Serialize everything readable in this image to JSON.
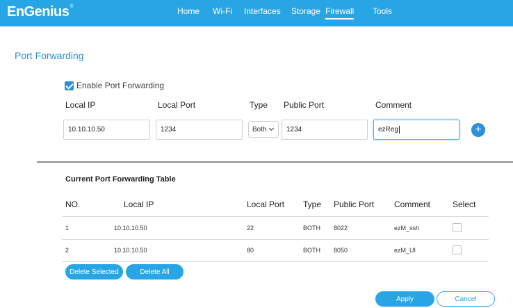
{
  "brand": {
    "name": "EnGenius",
    "mark": "®"
  },
  "nav": {
    "items": [
      {
        "label": "Home"
      },
      {
        "label": "Wi-Fi"
      },
      {
        "label": "Interfaces"
      },
      {
        "label": "Storage"
      },
      {
        "label": "Firewall",
        "active": true
      },
      {
        "label": "Tools"
      }
    ]
  },
  "page": {
    "title": "Port Forwarding"
  },
  "form": {
    "enable_label": "Enable Port Forwarding",
    "enabled": true,
    "labels": {
      "local_ip": "Local IP",
      "local_port": "Local Port",
      "type": "Type",
      "public_port": "Public Port",
      "comment": "Comment"
    },
    "values": {
      "local_ip": "10.10.10.50",
      "local_port": "1234",
      "type": "Both",
      "public_port": "1234",
      "comment": "ezReg"
    },
    "add_icon": "plus-icon",
    "add_symbol": "+"
  },
  "table": {
    "title": "Current Port Forwarding Table",
    "headers": {
      "no": "NO.",
      "local_ip": "Local IP",
      "local_port": "Local Port",
      "type": "Type",
      "public_port": "Public Port",
      "comment": "Comment",
      "select": "Select"
    },
    "rows": [
      {
        "no": "1",
        "local_ip": "10.10.10.50",
        "local_port": "22",
        "type": "BOTH",
        "public_port": "8022",
        "comment": "ezM_ssh"
      },
      {
        "no": "2",
        "local_ip": "10.10.10.50",
        "local_port": "80",
        "type": "BOTH",
        "public_port": "8050",
        "comment": "ezM_UI"
      }
    ]
  },
  "actions": {
    "delete_selected": "Delete Selected",
    "delete_all": "Delete All",
    "apply": "Apply",
    "cancel": "Cancel"
  },
  "colors": {
    "brand": "#28a5e4",
    "accent": "#2b8fe0"
  }
}
